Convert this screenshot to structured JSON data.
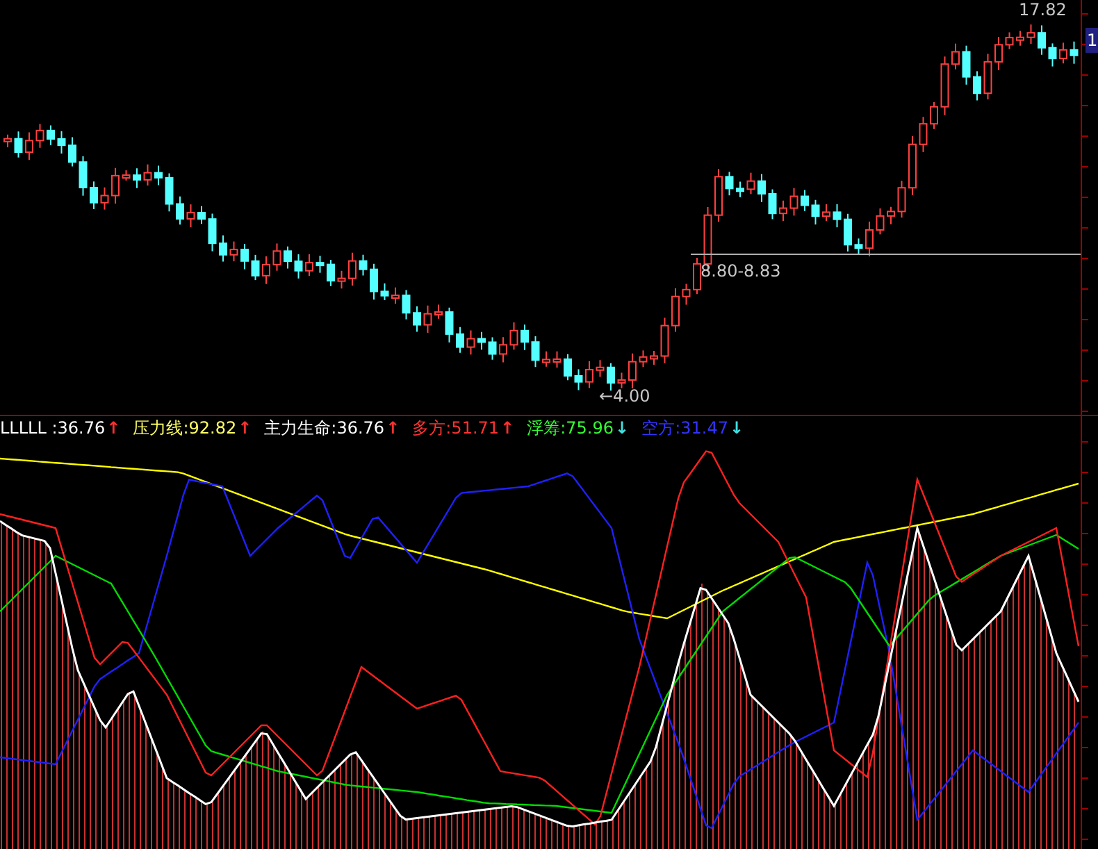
{
  "price_chart": {
    "high_label": "17.82",
    "range_label": "8.80-8.83",
    "low_label": "←4.00",
    "axis_tag": "1"
  },
  "indicator_legend": [
    {
      "label": "LLLLL :36.76",
      "arrow": "↑",
      "rising": true,
      "color": "#ffffff"
    },
    {
      "label": "压力线:92.82",
      "arrow": "↑",
      "rising": true,
      "color": "#ffff66"
    },
    {
      "label": "主力生命:36.76",
      "arrow": "↑",
      "rising": true,
      "color": "#ffffff"
    },
    {
      "label": "多方:51.71",
      "arrow": "↑",
      "rising": true,
      "color": "#ff3333"
    },
    {
      "label": "浮筹:75.96",
      "arrow": "↓",
      "rising": false,
      "color": "#33ff33"
    },
    {
      "label": "空方:31.47",
      "arrow": "↓",
      "rising": false,
      "color": "#3333ff"
    }
  ]
}
